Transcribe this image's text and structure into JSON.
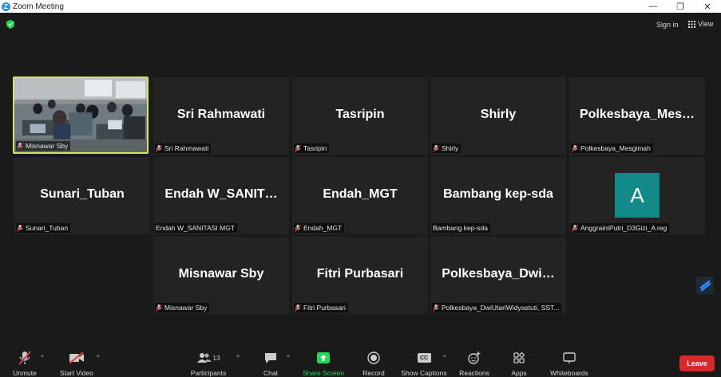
{
  "window": {
    "title": "Zoom Meeting",
    "minimize": "—",
    "restore": "❐",
    "close": "✕"
  },
  "top": {
    "sign_in": "Sign in",
    "view": "View"
  },
  "participants_grid": [
    {
      "id": "t1",
      "label": "Misnawar Sby",
      "big": "",
      "muted": true,
      "video": true
    },
    {
      "id": "t2",
      "label": "Sri Rahmawati",
      "big": "Sri Rahmawati",
      "muted": true
    },
    {
      "id": "t3",
      "label": "Tasripin",
      "big": "Tasripin",
      "muted": true
    },
    {
      "id": "t4",
      "label": "Shirly",
      "big": "Shirly",
      "muted": true
    },
    {
      "id": "t5",
      "label": "Polkesbaya_Mesgimah",
      "big": "Polkesbaya_Mes…",
      "muted": true
    },
    {
      "id": "t6",
      "label": "Sunari_Tuban",
      "big": "Sunari_Tuban",
      "muted": true
    },
    {
      "id": "t7",
      "label": "Endah W_SANITASI MGT",
      "big": "Endah W_SANIT…",
      "muted": false
    },
    {
      "id": "t8",
      "label": "Endah_MGT",
      "big": "Endah_MGT",
      "muted": true
    },
    {
      "id": "t9",
      "label": "Bambang kep-sda",
      "big": "Bambang kep-sda",
      "muted": false
    },
    {
      "id": "t10",
      "label": "AnggrainiPutri_D3Gizi_A reg",
      "big": "",
      "avatar_letter": "A",
      "muted": true
    },
    {
      "id": "t11",
      "label": "Misnawar Sby",
      "big": "Misnawar Sby",
      "muted": true
    },
    {
      "id": "t12",
      "label": "Fitri Purbasari",
      "big": "Fitri Purbasari",
      "muted": true
    },
    {
      "id": "t13",
      "label": "Polkesbaya_DwiUtariWidyastuti, SST...",
      "big": "Polkesbaya_Dwi…",
      "muted": true
    }
  ],
  "toolbar": {
    "unmute": "Unmute",
    "start_video": "Start Video",
    "participants": "Participants",
    "participants_count": "13",
    "chat": "Chat",
    "share_screen": "Share Screen",
    "record": "Record",
    "show_captions": "Show Captions",
    "captions_icon_text": "CC",
    "reactions": "Reactions",
    "apps": "Apps",
    "whiteboards": "Whiteboards",
    "leave": "Leave"
  },
  "colors": {
    "accent_green": "#23d959",
    "leave_red": "#d7292b",
    "active_border": "#d4e65a",
    "avatar_teal": "#138a8a"
  }
}
